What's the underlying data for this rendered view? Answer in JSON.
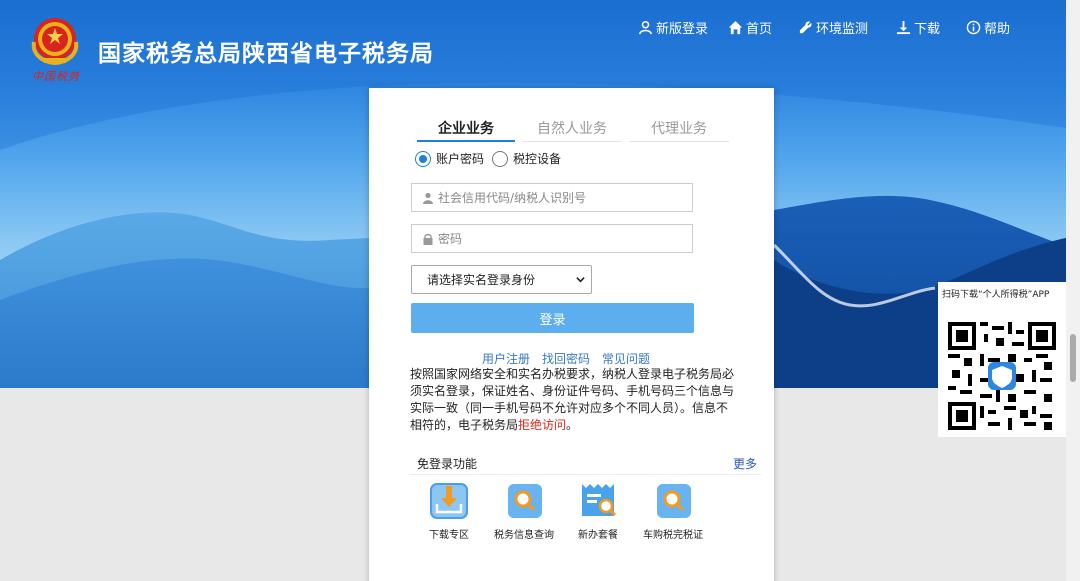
{
  "header": {
    "title": "国家税务总局陕西省电子税务局",
    "seal_text": "中国税务"
  },
  "topnav": [
    {
      "label": "新版登录",
      "icon": "user-icon"
    },
    {
      "label": "首页",
      "icon": "home-icon"
    },
    {
      "label": "环境监测",
      "icon": "wrench-icon"
    },
    {
      "label": "下载",
      "icon": "download-icon"
    },
    {
      "label": "帮助",
      "icon": "info-icon"
    }
  ],
  "login": {
    "tabs": [
      "企业业务",
      "自然人业务",
      "代理业务"
    ],
    "active_tab": "企业业务",
    "radio_options": [
      "账户密码",
      "税控设备"
    ],
    "selected_radio": "账户密码",
    "username_placeholder": "社会信用代码/纳税人识别号",
    "password_placeholder": "密码",
    "identity_select": "请选择实名登录身份",
    "login_button": "登录",
    "links": [
      "用户注册",
      "找回密码",
      "常见问题"
    ],
    "notice_main": "按照国家网络安全和实名办税要求，纳税人登录电子税务局必须实名登录，保证姓名、身份证件号码、手机号码三个信息与实际一致（同一手机号码不允许对应多个不同人员）。信息不相符的，电子税务局",
    "notice_deny": "拒绝访问",
    "notice_end": "。"
  },
  "free_login": {
    "heading": "免登录功能",
    "more": "更多",
    "items": [
      {
        "label": "下载专区",
        "icon": "download-tray-icon"
      },
      {
        "label": "税务信息查询",
        "icon": "search-doc-icon"
      },
      {
        "label": "新办套餐",
        "icon": "package-search-icon"
      },
      {
        "label": "车购税完税证",
        "icon": "search-doc-icon"
      }
    ]
  },
  "qr": {
    "caption": "扫码下载“个人所得税”APP"
  },
  "colors": {
    "accent": "#1f7fe0",
    "login_button": "#5caeee",
    "deny_text": "#e3231a",
    "link": "#3878c8"
  }
}
